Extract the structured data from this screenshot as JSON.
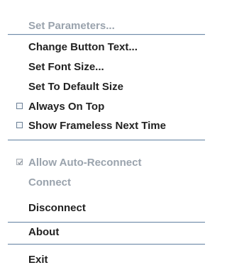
{
  "menu": {
    "set_parameters": "Set Parameters...",
    "change_button_text": "Change Button Text...",
    "set_font_size": "Set Font Size...",
    "set_default_size": "Set To Default Size",
    "always_on_top": "Always On Top",
    "show_frameless": "Show Frameless Next Time",
    "allow_auto_reconnect": "Allow Auto-Reconnect",
    "connect": "Connect",
    "disconnect": "Disconnect",
    "about": "About",
    "exit": "Exit"
  },
  "state": {
    "always_on_top_checked": false,
    "show_frameless_checked": false,
    "allow_auto_reconnect_checked": true,
    "allow_auto_reconnect_enabled": false,
    "set_parameters_enabled": false,
    "connect_enabled": false
  },
  "colors": {
    "separator": "#6f8aa8",
    "disabled_text": "#9aa3ad",
    "text": "#222222"
  }
}
